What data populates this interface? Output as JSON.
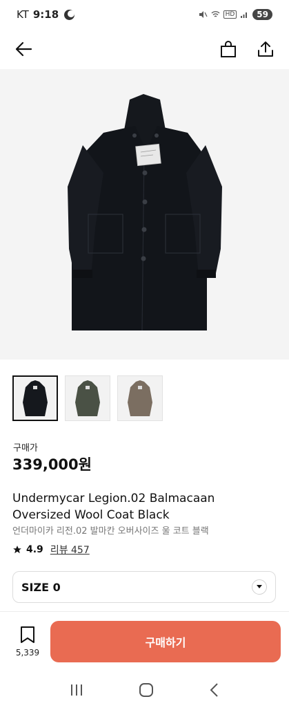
{
  "status_bar": {
    "carrier": "KT",
    "time": "9:18",
    "battery": "59",
    "net": "HD"
  },
  "header": {
    "back_icon": "arrow-left-icon",
    "bag_icon": "shopping-bag-icon",
    "share_icon": "share-icon"
  },
  "product": {
    "price_label": "구매가",
    "price": "339,000원",
    "title_en_line1": "Undermycar Legion.02 Balmacaan",
    "title_en_line2": "Oversized Wool Coat Black",
    "title_ko": "언더마이카 리전.02 발마칸 오버사이즈 울 코트 블랙",
    "rating": "4.9",
    "review_label": "리뷰 457"
  },
  "thumbnails": [
    {
      "color": "#15181d",
      "selected": true
    },
    {
      "color": "#4a5145",
      "selected": false
    },
    {
      "color": "#7b6e61",
      "selected": false
    }
  ],
  "size_select": {
    "value": "SIZE 0"
  },
  "bottom": {
    "wish_count": "5,339",
    "buy_label": "구매하기",
    "buy_color": "#e96b52"
  },
  "colors": {
    "coat": "#15181d",
    "accent": "#e96b52"
  }
}
